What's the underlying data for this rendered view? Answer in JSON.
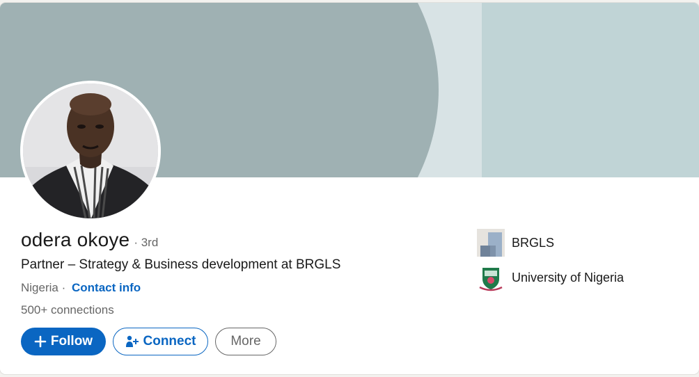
{
  "profile": {
    "name": "odera okoye",
    "degree": "· 3rd",
    "headline": "Partner – Strategy & Business development at BRGLS",
    "location": "Nigeria ·",
    "contact_info": "Contact info",
    "connections": "500+ connections"
  },
  "actions": {
    "follow": "Follow",
    "connect": "Connect",
    "more": "More"
  },
  "side": {
    "company": "BRGLS",
    "school": "University of Nigeria"
  },
  "colors": {
    "accent": "#0a66c2",
    "banner_dark": "#9fb1b3",
    "banner_light": "#d8e3e5",
    "banner_right": "#c0d4d6"
  },
  "icons": [
    "plus-icon",
    "add-person-icon",
    "brgls-logo",
    "unn-logo"
  ]
}
